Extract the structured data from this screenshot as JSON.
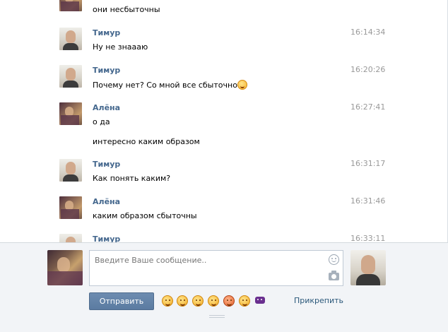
{
  "messages": [
    {
      "author": "",
      "time": "",
      "text": "они несбыточны",
      "avatar": "alena",
      "continuation": true
    },
    {
      "author": "Тимур",
      "time": "16:14:34",
      "text": "Ну не знаааю",
      "avatar": "timur"
    },
    {
      "author": "Тимур",
      "time": "16:20:26",
      "text": "Почему нет? Со мной все сбыточно",
      "avatar": "timur",
      "emoji": "smile-icon"
    },
    {
      "author": "Алёна",
      "time": "16:27:41",
      "text": "о да",
      "avatar": "alena"
    },
    {
      "author": "",
      "time": "",
      "text": "интересно каким образом",
      "avatar": "",
      "continuation": true
    },
    {
      "author": "Тимур",
      "time": "16:31:17",
      "text": "Как понять каким?",
      "avatar": "timur"
    },
    {
      "author": "Алёна",
      "time": "16:31:46",
      "text": "каким образом сбыточны",
      "avatar": "alena"
    },
    {
      "author": "Тимур",
      "time": "16:33:11",
      "text": "",
      "avatar": "timur"
    }
  ],
  "composer": {
    "placeholder": "Введите Ваше сообщение..",
    "send_label": "Отправить",
    "attach_label": "Прикрепить",
    "emojis": [
      "grin-icon",
      "smile-icon",
      "neutral-icon",
      "cool-icon",
      "angry-icon",
      "kiss-icon",
      "alien-icon"
    ]
  },
  "colors": {
    "author": "#45688e",
    "time": "#999999",
    "send_button": "#5b7ba1",
    "link": "#2b587a",
    "composer_bg": "#f2f4f7"
  }
}
